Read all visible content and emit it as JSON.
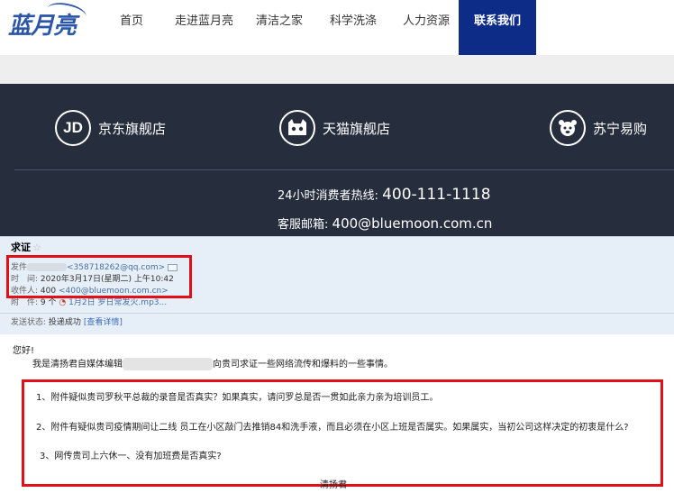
{
  "nav": {
    "logo": "蓝月亮",
    "items": [
      "首页",
      "走进蓝月亮",
      "清洁之家",
      "科学洗涤",
      "人力资源",
      "联系我们"
    ],
    "active_index": 5
  },
  "stores": [
    {
      "icon": "jd-icon",
      "icon_text": "JD",
      "name": "京东旗舰店"
    },
    {
      "icon": "tmall-icon",
      "name": "天猫旗舰店"
    },
    {
      "icon": "suning-icon",
      "name": "苏宁易购"
    }
  ],
  "contact": {
    "hotline_label": "24小时消费者热线:",
    "hotline_number": "400-111-1118",
    "email_label": "客服邮箱:",
    "email": "400@bluemoon.com.cn"
  },
  "email": {
    "subject": "求证",
    "star": "☆",
    "from_label": "发件",
    "from_address": "<358718262@qq.com>",
    "time_label": "时　间:",
    "time": "2020年3月17日(星期二) 上午10:42",
    "to_label": "收件人:",
    "to_name": "400",
    "to_address": "<400@bluemoon.com.cn>",
    "attach_label": "附　件:",
    "attach_count": "9 个",
    "attach_name": "1月2日 罗日常发火.mp3...",
    "status_label": "发送状态:",
    "status_value": "投递成功",
    "status_link": "[查看详情]",
    "greeting": "您好!",
    "intro_prefix": "我是清扬君自媒体编辑",
    "intro_suffix": "向贵司求证一些网络流传和爆料的一些事情。",
    "items": [
      "1、附件疑似贵司罗秋平总裁的录音是否真实？如果真实，请问罗总是否一贯如此亲力亲为培训员工。",
      "2、附件有疑似贵司疫情期间让二线 员工在小区敲门去推销84和洗手液，而且必须在小区上班是否属实。如果属实，当初公司这样决定的初衷是什么?",
      "3、网传贵司上六休一、没有加班费是否真实?"
    ],
    "signature": "清扬君"
  },
  "colors": {
    "nav_active": "#0c2c88",
    "dark_band": "#262d3d",
    "highlight_box": "#e30f17",
    "email_header_bg": "#e6eff8"
  }
}
